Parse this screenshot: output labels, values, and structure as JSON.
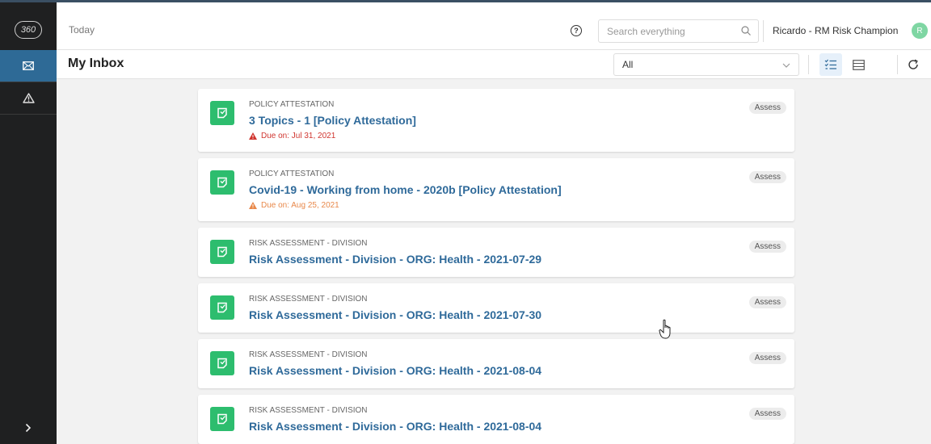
{
  "sidebar": {
    "logo_text": "360",
    "items": [
      {
        "name": "inbox",
        "icon": "envelope-icon",
        "active": true
      },
      {
        "name": "risks",
        "icon": "warning-triangle-icon",
        "active": false
      }
    ],
    "expand_icon": "chevron-right-icon"
  },
  "header": {
    "breadcrumb": "Today",
    "search": {
      "placeholder": "Search everything",
      "value": ""
    },
    "user_name": "Ricardo - RM Risk Champion",
    "avatar_initial": "R"
  },
  "titlebar": {
    "title": "My Inbox",
    "filter_value": "All"
  },
  "tasks": [
    {
      "category": "POLICY ATTESTATION",
      "title": "3 Topics - 1 [Policy Attestation]",
      "due": "Due on: Jul 31, 2021",
      "due_color": "#d0352f",
      "badge": "Assess"
    },
    {
      "category": "POLICY ATTESTATION",
      "title": "Covid-19 - Working from home - 2020b [Policy Attestation]",
      "due": "Due on: Aug 25, 2021",
      "due_color": "#e8884a",
      "badge": "Assess"
    },
    {
      "category": "RISK ASSESSMENT - DIVISION",
      "title": "Risk Assessment - Division - ORG: Health - 2021-07-29",
      "badge": "Assess"
    },
    {
      "category": "RISK ASSESSMENT - DIVISION",
      "title": "Risk Assessment - Division - ORG: Health - 2021-07-30",
      "badge": "Assess"
    },
    {
      "category": "RISK ASSESSMENT - DIVISION",
      "title": "Risk Assessment - Division - ORG: Health - 2021-08-04",
      "badge": "Assess"
    },
    {
      "category": "RISK ASSESSMENT - DIVISION",
      "title": "Risk Assessment - Division - ORG: Health - 2021-08-04",
      "badge": "Assess"
    }
  ],
  "colors": {
    "accent": "#2f6a9a",
    "sidebar_bg": "#1f2021",
    "sidebar_active": "#2e6a96",
    "task_icon": "#2dbd6e",
    "avatar": "#7fd6a3"
  }
}
